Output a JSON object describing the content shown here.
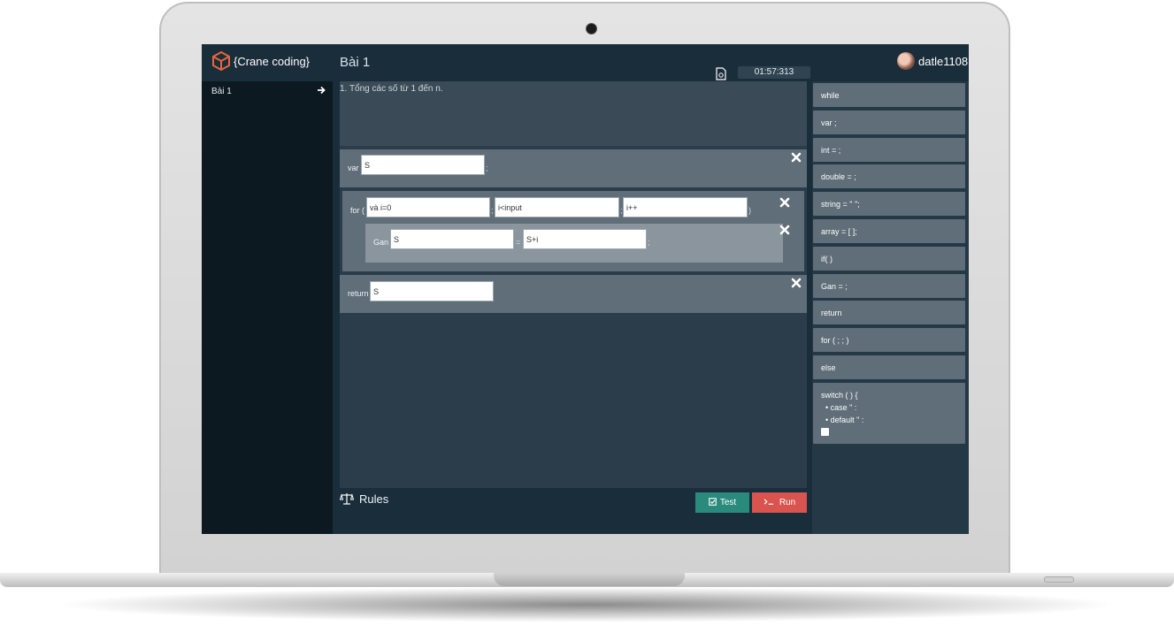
{
  "app": {
    "brand": "{Crane coding}",
    "title": "Bài 1",
    "timer": "01:57:313",
    "username": "datle1108"
  },
  "sidebar": {
    "items": [
      {
        "label": "Bài 1"
      }
    ]
  },
  "problem": {
    "text": "1. Tổng các số từ 1 đến n."
  },
  "blocks": {
    "var": {
      "keyword": "var",
      "value": "S",
      "semicolon": ";"
    },
    "for": {
      "keyword": "for (",
      "init": "và i=0",
      "condition": "i<input",
      "step": "i++",
      "sep1": ";",
      "sep2": ";",
      "close": ")",
      "assign": {
        "keyword": "Gan",
        "left": "S",
        "equals": "=",
        "right": "S+i",
        "semicolon": ";"
      }
    },
    "return": {
      "keyword": "return",
      "value": "S"
    }
  },
  "footer": {
    "rules_label": "Rules",
    "test_label": "Test",
    "run_label": "Run"
  },
  "palette": {
    "items": [
      "while",
      "var ;",
      "int = ;",
      "double = ;",
      "string = \" \";",
      "array = [ ];",
      "if( )",
      "Gan = ;",
      "return",
      "for ( ; ; )",
      "else"
    ],
    "switch": {
      "label": "switch ( ) {",
      "case": "•  case \" :",
      "default": "•  default \" :"
    }
  },
  "colors": {
    "screen_bg": "#1a2d3b",
    "block_bg": "#5f6e78",
    "test_button": "#2a8a7c",
    "run_button": "#d9534f",
    "logo_accent": "#e8663d"
  },
  "icons": [
    "cube-logo-icon",
    "arrow-right-icon",
    "document-icon",
    "close-icon",
    "scale-icon",
    "check-square-icon",
    "terminal-icon",
    "plus-icon"
  ]
}
